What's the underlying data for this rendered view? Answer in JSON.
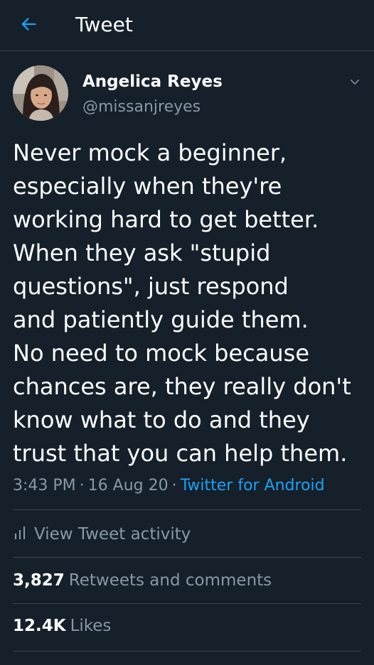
{
  "header": {
    "back_icon": "arrow-left-icon",
    "title": "Tweet"
  },
  "author": {
    "name": "Angelica Reyes",
    "handle": "@missanjreyes",
    "menu_icon": "chevron-down-icon"
  },
  "tweet": {
    "text": "Never mock a beginner,\nespecially when they're\nworking hard to get better.\nWhen they ask \"stupid\nquestions\", just respond\nand patiently guide them.\nNo need to mock because\nchances are, they really don't\nknow what to do and they\ntrust that you can help them.",
    "time": "3:43 PM",
    "date": "16 Aug 20",
    "separator": "·",
    "source": "Twitter for Android"
  },
  "activity": {
    "icon": "bar-chart-icon",
    "label": "View Tweet activity"
  },
  "stats": {
    "retweets_count": "3,827",
    "retweets_label": "Retweets and comments",
    "likes_count": "12.4K",
    "likes_label": "Likes"
  },
  "colors": {
    "background": "#15202b",
    "accent": "#1da1f2",
    "secondary_text": "#8899a6",
    "divider": "#38444d"
  }
}
